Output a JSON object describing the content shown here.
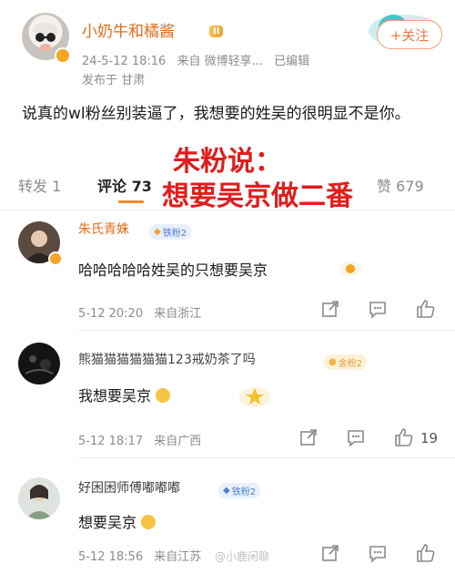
{
  "post": {
    "author": "小奶牛和橘酱",
    "level_badge": "II",
    "time": "24-5-12 18:16",
    "source": "来自 微博轻享...",
    "edited": "已编辑",
    "location": "发布于 甘肃",
    "follow": "+关注",
    "text": "说真的wl粉丝别装逼了，我想要的姓吴的很明显不是你。"
  },
  "tabs": {
    "repost": "转发 1",
    "comments": "评论 73",
    "likes_count": "679"
  },
  "overlay": {
    "line1": "朱粉说：",
    "line2": "想要吴京做二番"
  },
  "comments": [
    {
      "name": "朱氏青姝",
      "badge": "铁粉2",
      "text": "哈哈哈哈哈姓吴的只想要吴京",
      "date": "5-12 20:20",
      "location": "来自浙江",
      "likes": ""
    },
    {
      "name": "熊猫猫猫猫猫猫123戒奶茶了吗",
      "badge": "金粉2",
      "text": "我想要吴京",
      "date": "5-12 18:17",
      "location": "来自广西",
      "likes": "19"
    },
    {
      "name": "好困困师傅嘟嘟嘟",
      "badge": "铁粉2",
      "text": "想要吴京",
      "date": "5-12 18:56",
      "location": "来自江苏",
      "likes": ""
    }
  ],
  "watermark": "@小鹿闲聊"
}
